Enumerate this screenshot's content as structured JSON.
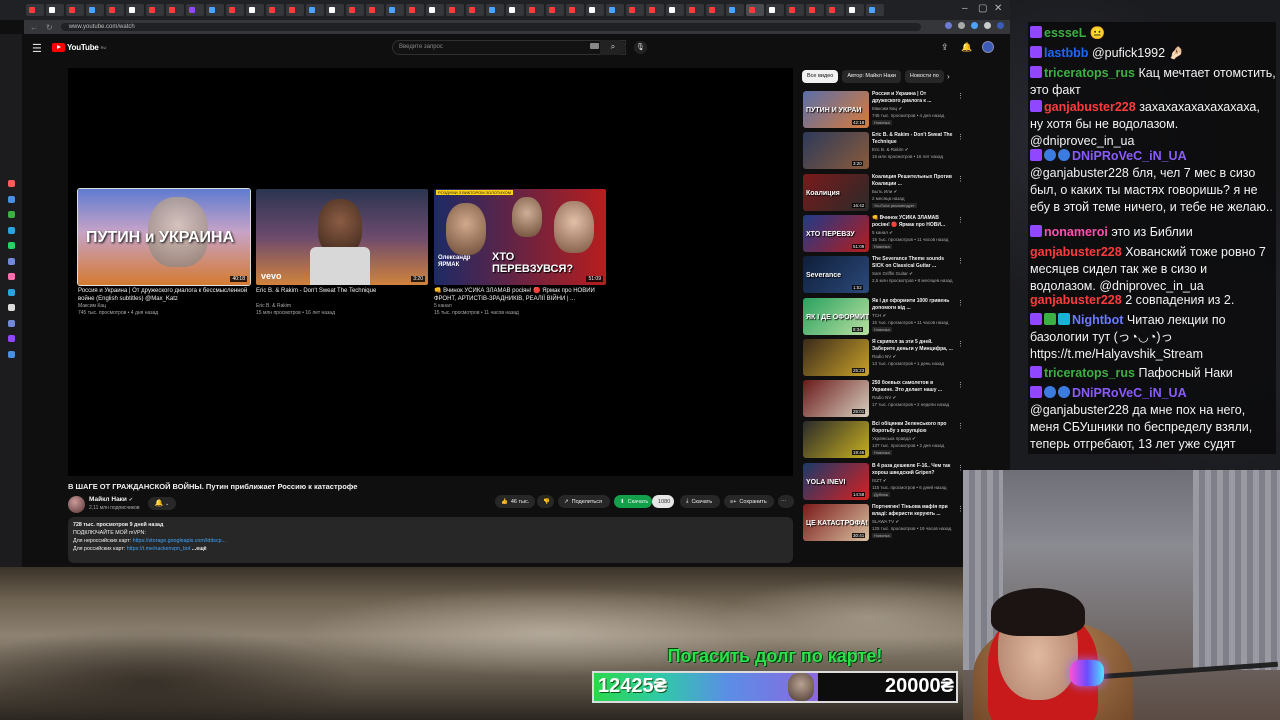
{
  "browser": {
    "url": "www.youtube.com/watch",
    "tab_colors": [
      "#ff3b3b",
      "#ffffff",
      "#ff3b3b",
      "#4aa3ff",
      "#ff3b3b",
      "#ffffff",
      "#ff3b3b",
      "#ff3b3b",
      "#9146ff",
      "#4aa3ff",
      "#ff3b3b",
      "#ffffff",
      "#ff3b3b",
      "#ff3b3b",
      "#4aa3ff",
      "#ffffff",
      "#ff3b3b",
      "#ff3b3b",
      "#4aa3ff",
      "#ff3b3b",
      "#ffffff",
      "#ff3b3b",
      "#ff3b3b",
      "#4aa3ff",
      "#ffffff",
      "#ff3b3b",
      "#ff3b3b",
      "#ff3b3b",
      "#ffffff",
      "#4aa3ff",
      "#ff3b3b",
      "#ff3b3b",
      "#ffffff",
      "#ff3b3b",
      "#ff3b3b",
      "#4aa3ff",
      "#ff3b3b",
      "#ffffff",
      "#ff3b3b",
      "#ff3b3b",
      "#ff3b3b",
      "#ffffff",
      "#4aa3ff"
    ],
    "dock_colors": [
      "#ff5b5b",
      "#4a90e2",
      "#3cb043",
      "#2aa3e0",
      "#25d366",
      "#7289da",
      "#ff6fb0",
      "#2aa3e0",
      "#dddddd",
      "#7289da",
      "#9146ff",
      "#4a90e2"
    ]
  },
  "youtube": {
    "logo_text": "YouTube",
    "logo_sup": "RU",
    "search_placeholder": "Введите запрос",
    "player": {
      "endcards": [
        {
          "title": "Россия и Украина | От дружеского диалога к бессмысленной войне (English subtitles) @Max_Katz",
          "channel": "Максим Кац",
          "views": "745 тыс. просмотров • 4 дня назад",
          "duration": "40:18",
          "thumb_text": "ПУТИН и УКРАИНА"
        },
        {
          "title": "Eric B. & Rakim - Don't Sweat The Technique",
          "channel": "Eric B. & Rakim",
          "views": "15 млн просмотров • 16 лет назад",
          "duration": "3:20",
          "thumb_text": "vevo"
        },
        {
          "title": "👊 Вчинок УСИКА ЗЛАМАВ росіян! 🔴 Ярмак про НОВИЙ ФРОНТ, АРТИСТІВ-ЗРАДНИКІВ, РЕАЛІЇ ВІЙНИ | ...",
          "channel": "5 канал",
          "views": "15 тыс. просмотров • 11 часов назад",
          "duration": "51:09",
          "thumb_text": "ХТО ПЕРЕВЗУВСЯ?",
          "thumb_sub": "Олександр ЯРМАК",
          "thumb_tag": "РОЗДУМИ З ВИКТОРОМ ЗОЛОТИХОМ"
        }
      ]
    },
    "video": {
      "title": "В ШАГЕ ОТ ГРАЖДАНСКОЙ ВОЙНЫ. Путин приближает Россию к катастрофе",
      "channel": "Майкл Наки",
      "subscribers": "2,11 млн подписчиков",
      "likes": "46 тыс.",
      "share": "Поделиться",
      "download_green": "Скачать",
      "download_white": "1080",
      "download2": "Скачать",
      "save": "Сохранить",
      "desc_stats": "728 тыс. просмотров  9 дней назад",
      "desc_line1": "ПОДКЛЮЧАЙТЕ МОЙ mVPN:",
      "desc_line2_label": "Для нероссийских карт: ",
      "desc_line2_link": "https://storage.googleapis.com/lddscp...",
      "desc_line3_label": "Для российских карт: ",
      "desc_line3_link": "https://t.me/nackenvpn_bot",
      "desc_more": " ...ещё"
    },
    "chips": [
      "Все видео",
      "Автор: Майкл Наки",
      "Новости по"
    ],
    "recommendations": [
      {
        "title": "Россия и Украина | От дружеского диалога к ...",
        "channel": "Максим Кац ✔",
        "views": "745 тыс. просмотров • 4 дня назад",
        "badge": "Новинка",
        "duration": "42:18",
        "colors": [
          "#5a6ea8",
          "#d77b3a"
        ],
        "tt": "ПУТИН И УКРАИ"
      },
      {
        "title": "Eric B. & Rakim - Don't Sweat The Technique",
        "channel": "Eric B. & Rakim ✔",
        "views": "15 млн просмотров • 16 лет назад",
        "badge": "",
        "duration": "3:20",
        "colors": [
          "#2c3a5a",
          "#8a5a3a"
        ],
        "tt": ""
      },
      {
        "title": "Коалиция Решительных Против Коалиции ...",
        "channel": "Быть Или ✔",
        "views": "2 месяца назад",
        "badge": "YouTube рекомендует",
        "duration": "16:42",
        "colors": [
          "#7a1a1a",
          "#2a2a2a"
        ],
        "tt": "Коалиция"
      },
      {
        "title": "👊 Вчинок УСИКА ЗЛАМАВ росіян! 🔴 Ярмак про НОВИ...",
        "channel": "5 канал ✔",
        "views": "15 тыс. просмотров • 11 часов назад",
        "badge": "Новинка",
        "duration": "51:09",
        "colors": [
          "#1f3a8a",
          "#b51d1d"
        ],
        "tt": "ХТО ПЕРЕВЗУ"
      },
      {
        "title": "The Severance Theme sounds SICK on Classical Guitar ...",
        "channel": "Sam Griffin Guitar ✔",
        "views": "2,5 млн просмотров • 8 месяцев назад",
        "badge": "",
        "duration": "1:52",
        "colors": [
          "#0e1e3a",
          "#2c4a7a"
        ],
        "tt": "Severance"
      },
      {
        "title": "Як і де оформити 1000 гривень допомоги від ...",
        "channel": "ТСН ✔",
        "views": "15 тыс. просмотров • 11 часов назад",
        "badge": "Новинка",
        "duration": "8:34",
        "colors": [
          "#2aa160",
          "#b8e0a0"
        ],
        "tt": "ЯК І ДЕ ОФОРМИТИ 1000 ГРИВЕНЬ"
      },
      {
        "title": "Я скрипел за эти 5 дней. Заберите деньги у Минцифра, ...",
        "channel": "Radio NV ✔",
        "views": "13 тыс. просмотров • 1 день назад",
        "badge": "",
        "duration": "25:23",
        "colors": [
          "#3a2a1a",
          "#c9a22a"
        ],
        "tt": ""
      },
      {
        "title": "250 боевых самолетов в Украине. Это делает нашу ...",
        "channel": "Radio NV ✔",
        "views": "17 тыс. просмотров • 2 недели назад",
        "badge": "",
        "duration": "25:01",
        "colors": [
          "#6a1a1a",
          "#d8d0c0"
        ],
        "tt": ""
      },
      {
        "title": "Всі обіцянки Зеленського про боротьбу з корупцією",
        "channel": "Українська правда ✔",
        "views": "137 тыс. просмотров • 2 дня назад",
        "badge": "Новинка",
        "duration": "19:46",
        "colors": [
          "#2a2a2a",
          "#c8b020"
        ],
        "tt": ""
      },
      {
        "title": "В 4 раза дешевле F-16.. Чем так хорош шведский Gripen?",
        "channel": "ISZT ✔",
        "views": "115 тыс. просмотров • 6 дней назад",
        "badge": "Дубляж",
        "duration": "14:58",
        "colors": [
          "#1a3a6a",
          "#d82020"
        ],
        "tt": "YOLA INEVI"
      },
      {
        "title": "Портнягин! Тіньова мафія при владі: аферисти керують ...",
        "channel": "SLAWA TV ✔",
        "views": "125 тыс. просмотров • 19 часов назад",
        "badge": "Новинка",
        "duration": "30:41",
        "colors": [
          "#7a1a1a",
          "#d8c0a0"
        ],
        "tt": "ЦЕ КАТАСТРОФА!"
      }
    ]
  },
  "overlay": {
    "donate_title": "Погасить долг по карте!",
    "donate_current": "12425₴",
    "donate_goal": "20000₴",
    "donate_progress": 0.62
  },
  "chat": {
    "messages": [
      {
        "nick": "essseL",
        "nick_color": "#3cb043",
        "badges": [
          "tw"
        ],
        "text": " 😐"
      },
      {
        "nick": "lastbbb",
        "nick_color": "#1e66ff",
        "badges": [
          "tw"
        ],
        "text": "@pufick1992 🤌🏻"
      },
      {
        "nick": "triceratops_rus",
        "nick_color": "#3cb043",
        "badges": [
          "tw"
        ],
        "text": "Кац мечтает отомстить, это факт"
      },
      {
        "nick": "ganjabuster228",
        "nick_color": "#ff3b3b",
        "badges": [
          "tw"
        ],
        "text": "захахахахахахахаха, ну хотя бы не водолазом. @dniprovec_in_ua"
      },
      {
        "nick": "DNiPRoVeC_iN_UA",
        "nick_color": "#8a5cff",
        "badges": [
          "tw",
          "gm",
          "gm"
        ],
        "text": "@ganjabuster228 бля, чел 7 мес в сизо был, о каких ты мастях говоришь? я не ебу в этой теме ничего, и тебе не желаю.."
      },
      {
        "nick": "nonameroi",
        "nick_color": "#ff4fb0",
        "badges": [
          "tw"
        ],
        "text": "это из Библии"
      },
      {
        "nick": "ganjabuster228",
        "nick_color": "#ff3b3b",
        "badges": [],
        "text": "Хованский тоже ровно 7 месяцев сидел так же в сизо и водолазом. @dniprovec_in_ua"
      },
      {
        "nick": "ganjabuster228",
        "nick_color": "#ff3b3b",
        "badges": [],
        "text": "2 совпадения из 2."
      },
      {
        "nick": "Nightbot",
        "nick_color": "#6b7bff",
        "badges": [
          "tw",
          "ok",
          "ln"
        ],
        "text": "Читаю лекции по базологии тут (っ◔◡◔)っ https://t.me/Halyavshik_Stream"
      },
      {
        "nick": "triceratops_rus",
        "nick_color": "#3cb043",
        "badges": [
          "tw"
        ],
        "text": "Пафосный Наки"
      },
      {
        "nick": "DNiPRoVeC_iN_UA",
        "nick_color": "#8a5cff",
        "badges": [
          "tw",
          "gm",
          "gm"
        ],
        "text": "@ganjabuster228 да мне пох на него, меня СБУшники по беспределу взяли, теперь отгребают, 13 лет уже судят"
      }
    ]
  }
}
